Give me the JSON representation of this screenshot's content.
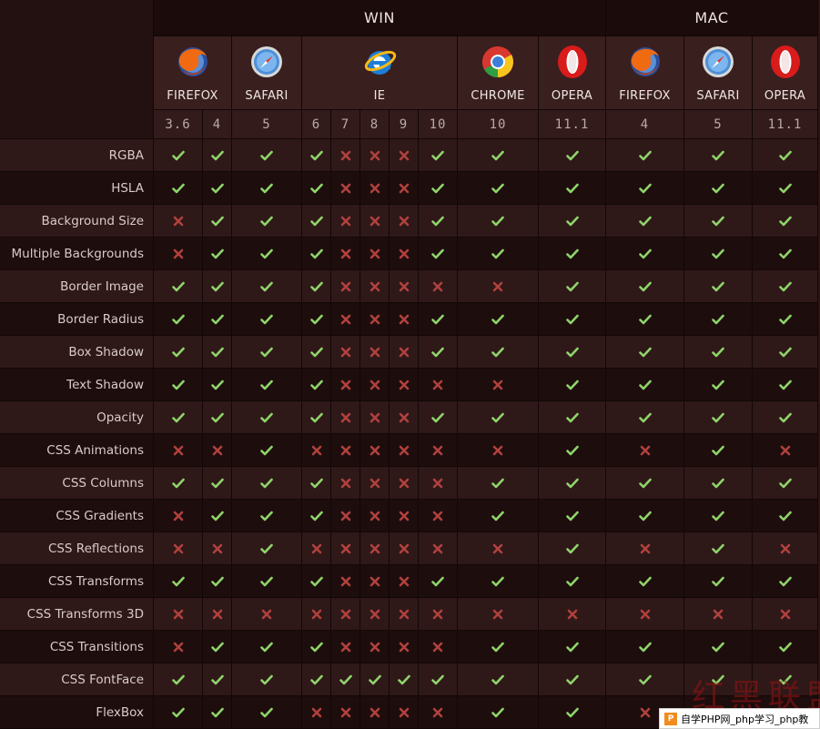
{
  "os_headers": [
    {
      "label": "WIN",
      "start": 2,
      "span": 10
    },
    {
      "label": "MAC",
      "start": 12,
      "span": 3
    }
  ],
  "browsers": [
    {
      "name": "FIREFOX",
      "icon": "firefox",
      "start": 2,
      "span": 2
    },
    {
      "name": "SAFARI",
      "icon": "safari",
      "start": 4,
      "span": 1
    },
    {
      "name": "IE",
      "icon": "ie",
      "start": 5,
      "span": 5
    },
    {
      "name": "CHROME",
      "icon": "chrome",
      "start": 10,
      "span": 1
    },
    {
      "name": "OPERA",
      "icon": "opera",
      "start": 11,
      "span": 1
    },
    {
      "name": "FIREFOX",
      "icon": "firefox",
      "start": 12,
      "span": 1
    },
    {
      "name": "SAFARI",
      "icon": "safari",
      "start": 13,
      "span": 1
    },
    {
      "name": "OPERA",
      "icon": "opera",
      "start": 14,
      "span": 1
    }
  ],
  "versions": [
    "3.6",
    "4",
    "5",
    "6",
    "7",
    "8",
    "9",
    "10",
    "10",
    "11.1",
    "4",
    "5",
    "11.1"
  ],
  "colors": {
    "yes": "#8ed46a",
    "no": "#b0413e"
  },
  "features": [
    {
      "name": "RGBA",
      "support": "1111000111111"
    },
    {
      "name": "HSLA",
      "support": "1111000111111"
    },
    {
      "name": "Background Size",
      "support": "0111000111111"
    },
    {
      "name": "Multiple Backgrounds",
      "support": "0111000111111"
    },
    {
      "name": "Border Image",
      "support": "1111000001111"
    },
    {
      "name": "Border Radius",
      "support": "1111000111111"
    },
    {
      "name": "Box Shadow",
      "support": "1111000111111"
    },
    {
      "name": "Text Shadow",
      "support": "1111000001111"
    },
    {
      "name": "Opacity",
      "support": "1111000111111"
    },
    {
      "name": "CSS Animations",
      "support": "0010000001010"
    },
    {
      "name": "CSS Columns",
      "support": "1111000011111"
    },
    {
      "name": "CSS Gradients",
      "support": "0111000011111"
    },
    {
      "name": "CSS Reflections",
      "support": "0010000001010"
    },
    {
      "name": "CSS Transforms",
      "support": "1111000111111"
    },
    {
      "name": "CSS Transforms 3D",
      "support": "0000000000000"
    },
    {
      "name": "CSS Transitions",
      "support": "0111000011111"
    },
    {
      "name": "CSS FontFace",
      "support": "1111111111111"
    },
    {
      "name": "FlexBox",
      "support": "1110000011010"
    }
  ],
  "watermark": {
    "text": "自学PHP网_php学习_php教",
    "art": "红黑联盟"
  }
}
